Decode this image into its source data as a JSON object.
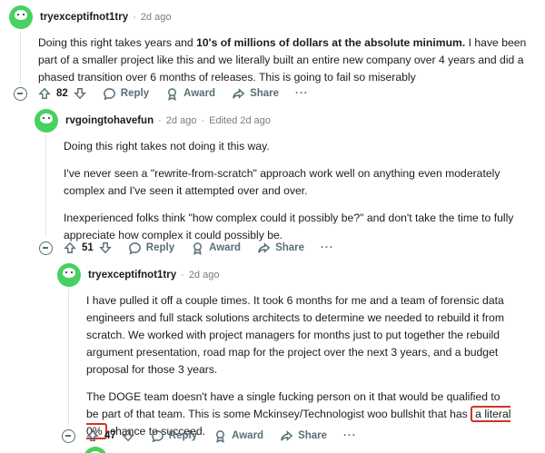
{
  "comments": [
    {
      "username": "tryexceptifnot1try",
      "time": "2d ago",
      "edited": "",
      "body_part1": "Doing this right takes years and ",
      "body_bold": "10's of millions of dollars at the absolute minimum.",
      "body_part2": " I have been part of a smaller project like this and we literally built an entire new company over 4 years and did a phased transition over 6 months of releases. This is going to fail so miserably",
      "upvotes": "82",
      "reply_label": "Reply",
      "award_label": "Award",
      "share_label": "Share",
      "more_label": "···"
    },
    {
      "username": "rvgoingtohavefun",
      "time": "2d ago",
      "edited": "Edited 2d ago",
      "paragraphs": [
        "Doing this right takes not doing it this way.",
        "I've never seen a \"rewrite-from-scratch\" approach work well on anything even moderately complex and I've seen it attempted over and over.",
        "Inexperienced folks think \"how complex could it possibly be?\" and don't take the time to fully appreciate how complex it could possibly be."
      ],
      "upvotes": "51",
      "reply_label": "Reply",
      "award_label": "Award",
      "share_label": "Share",
      "more_label": "···"
    },
    {
      "username": "tryexceptifnot1try",
      "time": "2d ago",
      "edited": "",
      "paragraph1": "I have pulled it off a couple times. It took 6 months for me and a team of forensic data engineers and full stack solutions architects to determine we needed to rebuild it from scratch. We worked with project managers for months just to put together the rebuild argument presentation, road map for the project over the next 3 years, and a budget proposal for those 3 years.",
      "paragraph2_pre": "The DOGE team doesn't have a single fucking person on it that would be qualified to be part of that team. This is some Mckinsey/Technologist woo bullshit that has",
      "paragraph2_highlight": "a literal 0%",
      "paragraph2_post": "chance to succeed.",
      "upvotes": "47",
      "reply_label": "Reply",
      "award_label": "Award",
      "share_label": "Share",
      "more_label": "···"
    }
  ],
  "colors": {
    "avatar_green": "#46d160",
    "highlight_red": "#d1332b",
    "meta_gray": "#7c7c7c",
    "action_gray": "#576f76"
  }
}
